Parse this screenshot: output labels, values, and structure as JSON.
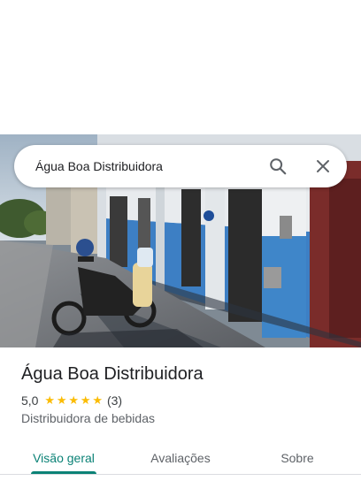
{
  "search": {
    "query": "Água Boa Distribuidora",
    "search_icon": "search-icon",
    "close_icon": "close-icon"
  },
  "photo": {
    "description_icon": "place-photo"
  },
  "place": {
    "name": "Água Boa Distribuidora",
    "rating": "5,0",
    "rating_stars": 5,
    "review_count": "(3)",
    "category": "Distribuidora de bebidas"
  },
  "tabs": [
    {
      "label": "Visão geral",
      "selected": true
    },
    {
      "label": "Avaliações",
      "selected": false
    },
    {
      "label": "Sobre",
      "selected": false
    }
  ],
  "colors": {
    "accent": "#0b8276",
    "star": "#fbbc04",
    "text_primary": "#202124",
    "text_secondary": "#5f6368"
  }
}
